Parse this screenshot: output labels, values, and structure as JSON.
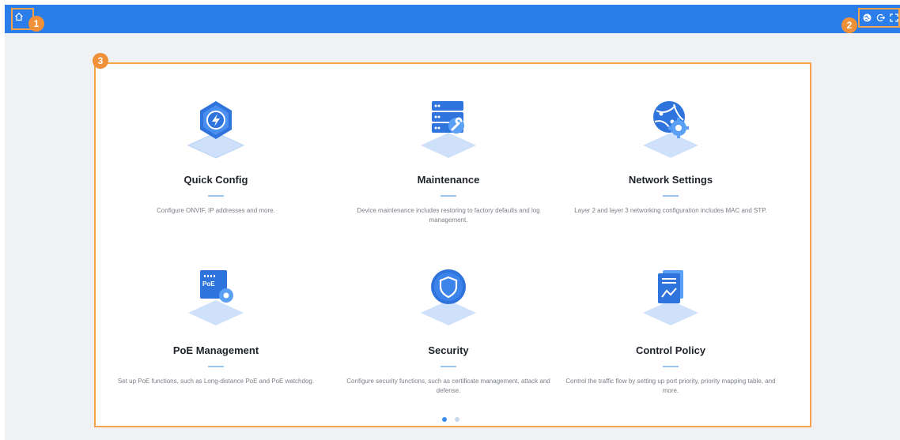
{
  "topbar": {
    "home_icon": "home-icon",
    "right_icons": [
      "globe-icon",
      "logout-icon",
      "fullscreen-icon"
    ],
    "accent": "#2b7de9"
  },
  "callouts": [
    "1",
    "2",
    "3"
  ],
  "cards": [
    {
      "title": "Quick Config",
      "desc": "Configure ONVIF, IP addresses and more.",
      "icon": "lightning-hexagon-icon"
    },
    {
      "title": "Maintenance",
      "desc": "Device maintenance includes restoring to factory defaults and log management.",
      "icon": "server-wrench-icon"
    },
    {
      "title": "Network Settings",
      "desc": "Layer 2 and layer 3 networking configuration includes MAC and STP.",
      "icon": "globe-gear-icon"
    },
    {
      "title": "PoE Management",
      "desc": "Set up PoE functions, such as Long-distance PoE and PoE watchdog.",
      "icon": "poe-chip-icon",
      "badge": "PoE"
    },
    {
      "title": "Security",
      "desc": "Configure security functions, such as certificate management, attack and defense.",
      "icon": "shield-icon"
    },
    {
      "title": "Control Policy",
      "desc": "Control the traffic flow by setting up port priority, priority mapping table, and more.",
      "icon": "document-chart-icon"
    }
  ],
  "pagination": {
    "pages": 2,
    "current": 1
  }
}
